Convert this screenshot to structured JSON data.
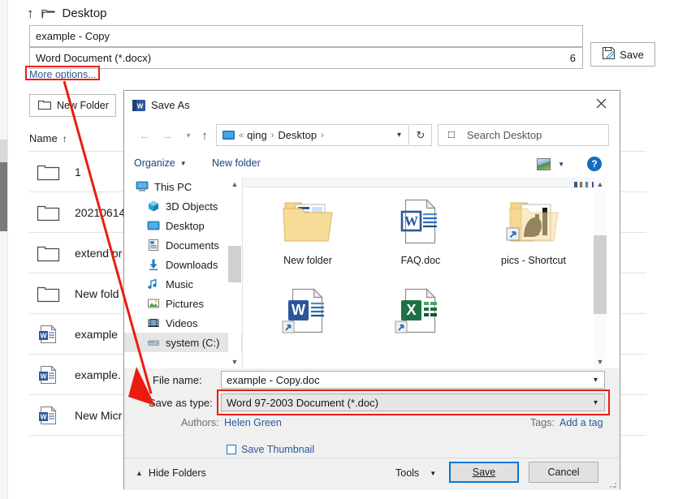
{
  "backstage": {
    "breadcrumb": {
      "up_icon": "up-arrow-icon",
      "folder_icon": "folder-icon",
      "location": "Desktop"
    },
    "filename_value": "example - Copy",
    "filetype_value": "Word Document (*.docx)",
    "filetype_count": "6",
    "save_label": "Save",
    "save_icon": "save-disk-icon",
    "more_options_label": "More options...",
    "new_folder_label": "New Folder",
    "new_folder_icon": "folder-icon",
    "column_header": "Name",
    "column_sort_arrow": "↑",
    "rows": [
      {
        "icon": "folder-icon",
        "name": "1"
      },
      {
        "icon": "folder-icon",
        "name": "20210614"
      },
      {
        "icon": "folder-icon",
        "name": "extend pr"
      },
      {
        "icon": "folder-icon",
        "name": "New fold"
      },
      {
        "icon": "word-doc-icon",
        "name": "example"
      },
      {
        "icon": "word-doc-icon",
        "name": "example."
      },
      {
        "icon": "word-doc-icon",
        "name": "New Micr"
      }
    ]
  },
  "dialog": {
    "title": "Save As",
    "title_icon": "word-app-icon",
    "close_icon": "close-icon",
    "nav": {
      "back_icon": "arrow-left-icon",
      "forward_icon": "arrow-right-icon",
      "recent_icon": "chevron-down-icon",
      "up_icon": "arrow-up-icon",
      "address_pc_icon": "this-pc-icon",
      "address_overflow": "«",
      "address_segments": [
        "qing",
        "Desktop"
      ],
      "address_dropdown_icon": "chevron-down-icon",
      "refresh_icon": "refresh-icon",
      "search_icon": "search-icon",
      "search_placeholder": "Search Desktop"
    },
    "toolbar": {
      "organize_label": "Organize",
      "organize_caret": "▼",
      "new_folder_label": "New folder",
      "view_icon": "view-layout-icon",
      "view_caret": "▼",
      "help_icon": "help-icon",
      "help_label": "?"
    },
    "nav_tree": [
      {
        "label": "This PC",
        "icon": "this-pc-icon",
        "indent": false,
        "selected": false
      },
      {
        "label": "3D Objects",
        "icon": "3d-objects-icon",
        "indent": true,
        "selected": false
      },
      {
        "label": "Desktop",
        "icon": "desktop-icon",
        "indent": true,
        "selected": false
      },
      {
        "label": "Documents",
        "icon": "documents-icon",
        "indent": true,
        "selected": false
      },
      {
        "label": "Downloads",
        "icon": "downloads-icon",
        "indent": true,
        "selected": false
      },
      {
        "label": "Music",
        "icon": "music-icon",
        "indent": true,
        "selected": false
      },
      {
        "label": "Pictures",
        "icon": "pictures-icon",
        "indent": true,
        "selected": false
      },
      {
        "label": "Videos",
        "icon": "videos-icon",
        "indent": true,
        "selected": false
      },
      {
        "label": "system (C:)",
        "icon": "drive-icon",
        "indent": true,
        "selected": true
      }
    ],
    "files": [
      {
        "name": "New folder",
        "icon": "folder-with-preview-icon",
        "shortcut": false
      },
      {
        "name": "FAQ.doc",
        "icon": "word-doc-icon",
        "shortcut": false
      },
      {
        "name": "pics - Shortcut",
        "icon": "folder-with-image-icon",
        "shortcut": true
      },
      {
        "name": "",
        "icon": "word-doc-icon",
        "shortcut": true
      },
      {
        "name": "",
        "icon": "excel-doc-icon",
        "shortcut": true
      }
    ],
    "form": {
      "filename_label": "File name:",
      "filename_value": "example - Copy.doc",
      "savetype_label": "Save as type:",
      "savetype_value": "Word 97-2003 Document (*.doc)",
      "authors_label": "Authors:",
      "authors_value": "Helen Green",
      "tags_label": "Tags:",
      "tags_value": "Add a tag",
      "thumbnail_label": "Save Thumbnail",
      "thumbnail_checked": false
    },
    "footer": {
      "hide_folders_label": "Hide Folders",
      "hide_folders_caret": "⌃",
      "tools_label": "Tools",
      "tools_caret": "▼",
      "save_label": "Save",
      "cancel_label": "Cancel"
    }
  },
  "annotations": {
    "highlight_color": "#ea1c0f",
    "arrow_from": "more-options-link",
    "arrow_to": "save-as-type-combo"
  }
}
